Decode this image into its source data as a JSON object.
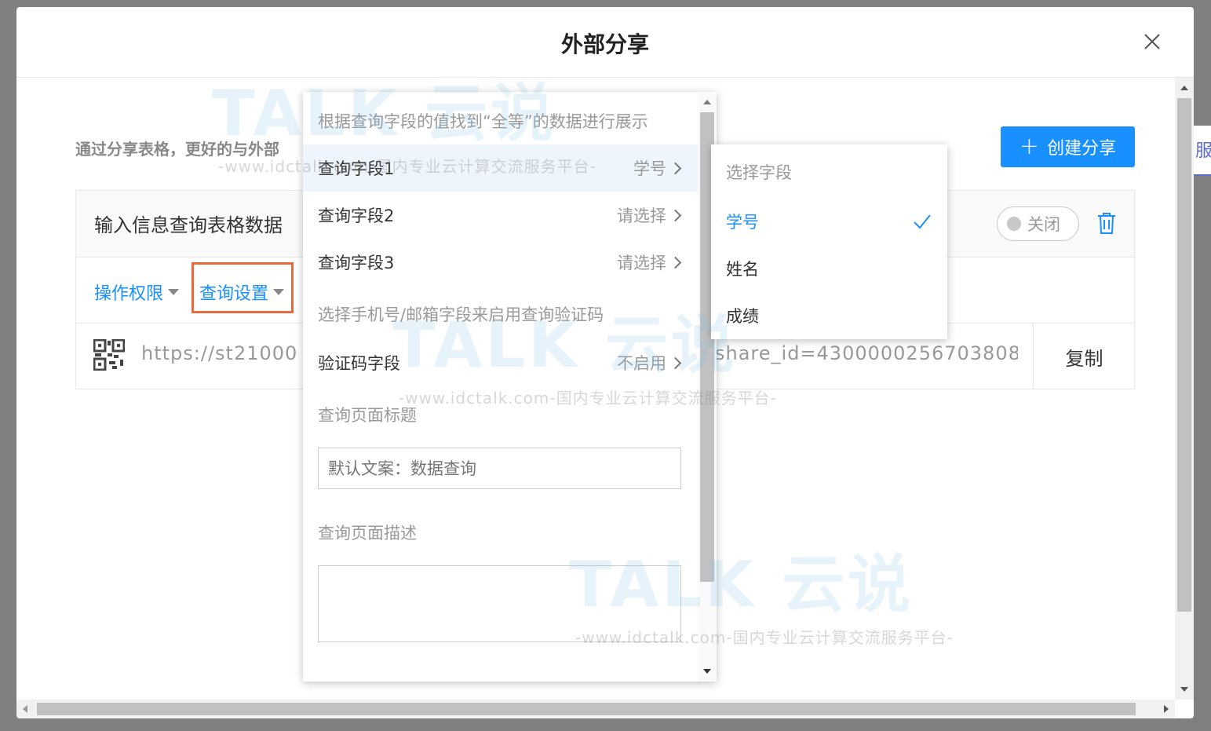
{
  "background": {
    "right_tab_char": "服"
  },
  "dialog": {
    "title": "外部分享",
    "description": "通过分享表格，更好的与外部",
    "create_button": "创建分享"
  },
  "share_card": {
    "title": "输入信息查询表格数据",
    "toggle_label": "关闭",
    "tabs": {
      "permissions": "操作权限",
      "query_settings": "查询设置"
    },
    "url_left": "https://st21000",
    "url_right": "share_id=4300000256703808",
    "copy_button": "复制"
  },
  "query_dropdown": {
    "hint": "根据查询字段的值找到“全等”的数据进行展示",
    "fields": [
      {
        "label": "查询字段1",
        "value": "学号"
      },
      {
        "label": "查询字段2",
        "value": "请选择"
      },
      {
        "label": "查询字段3",
        "value": "请选择"
      }
    ],
    "verify_hint": "选择手机号/邮箱字段来启用查询验证码",
    "verify_field": {
      "label": "验证码字段",
      "value": "不启用"
    },
    "page_title_label": "查询页面标题",
    "page_title_placeholder": "默认文案：数据查询",
    "page_desc_label": "查询页面描述"
  },
  "field_submenu": {
    "title": "选择字段",
    "options": [
      "学号",
      "姓名",
      "成绩"
    ],
    "selected": "学号"
  },
  "watermark": {
    "brand": "TALK 云说",
    "url": "-www.idctalk.com-国内专业云计算交流服务平台-"
  },
  "colors": {
    "accent": "#1890ff",
    "highlight": "#e86a3a"
  }
}
